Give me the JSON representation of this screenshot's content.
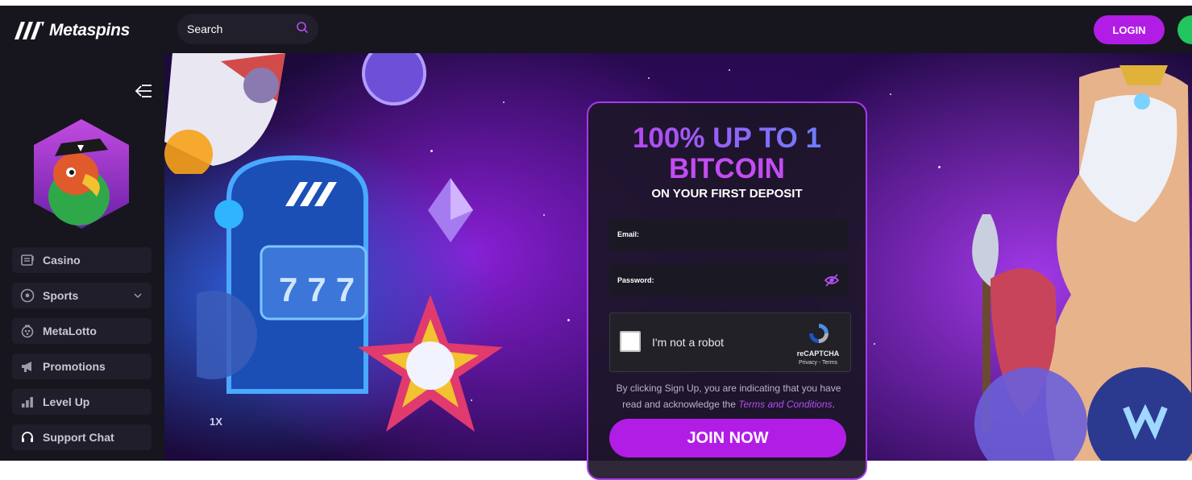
{
  "header": {
    "brand": "Metaspins",
    "search": {
      "label": "Search"
    },
    "login_label": "LOGIN"
  },
  "sidebar": {
    "items": [
      {
        "label": "Casino",
        "icon": "slot-machine-icon"
      },
      {
        "label": "Sports",
        "icon": "soccer-ball-icon",
        "has_submenu": true
      },
      {
        "label": "MetaLotto",
        "icon": "lottery-icon"
      },
      {
        "label": "Promotions",
        "icon": "megaphone-icon"
      },
      {
        "label": "Level Up",
        "icon": "bar-chart-icon"
      },
      {
        "label": "Support Chat",
        "icon": "headset-icon"
      }
    ]
  },
  "hero": {
    "slot_reels": [
      "7",
      "7",
      "7"
    ],
    "multiplier": "1X"
  },
  "signup": {
    "promo_line1": "100% UP TO 1",
    "promo_line2": "BITCOIN",
    "promo_sub": "ON YOUR FIRST DEPOSIT",
    "email_label": "Email:",
    "password_label": "Password:",
    "captcha": {
      "label": "I'm not a robot",
      "brand": "reCAPTCHA",
      "links": "Privacy - Terms"
    },
    "consent_text": "By clicking Sign Up, you are indicating that you have read and acknowledge the",
    "terms_link": "Terms and Conditions",
    "consent_end": ".",
    "join_label": "JOIN NOW"
  },
  "colors": {
    "accent": "#b21de6",
    "background": "#17161f",
    "signup_green": "#22c55e"
  }
}
